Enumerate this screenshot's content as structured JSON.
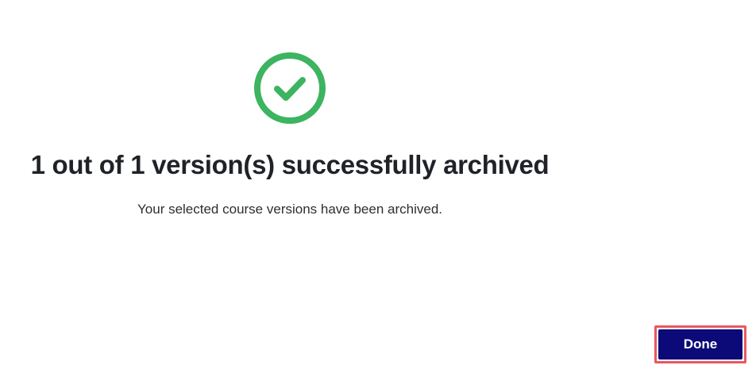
{
  "dialog": {
    "icon": "check-circle-icon",
    "title": "1 out of 1 version(s) successfully archived",
    "message": "Your selected course versions have been archived.",
    "done_label": "Done"
  },
  "colors": {
    "success": "#3cb460",
    "primary_button": "#0b0a78",
    "highlight_outline": "#e8585e"
  }
}
